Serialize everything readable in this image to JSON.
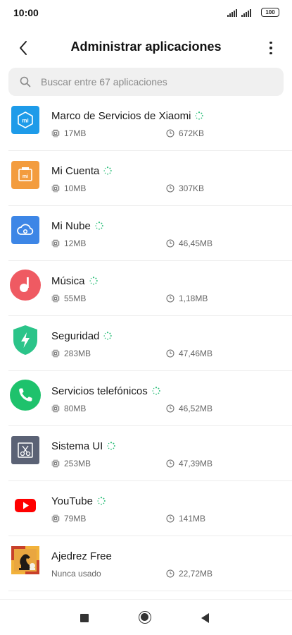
{
  "status_bar": {
    "time": "10:00",
    "battery": "100"
  },
  "header": {
    "title": "Administrar aplicaciones"
  },
  "search": {
    "placeholder": "Buscar entre 67 aplicaciones"
  },
  "apps": [
    {
      "name": "Marco de Servicios de Xiaomi",
      "size": "17MB",
      "cache": "672KB",
      "icon": "xiaomi-services-icon",
      "loading": true
    },
    {
      "name": "Mi Cuenta",
      "size": "10MB",
      "cache": "307KB",
      "icon": "mi-account-icon",
      "loading": true
    },
    {
      "name": "Mi Nube",
      "size": "12MB",
      "cache": "46,45MB",
      "icon": "mi-cloud-icon",
      "loading": true
    },
    {
      "name": "Música",
      "size": "55MB",
      "cache": "1,18MB",
      "icon": "music-icon",
      "loading": true
    },
    {
      "name": "Seguridad",
      "size": "283MB",
      "cache": "47,46MB",
      "icon": "security-icon",
      "loading": true
    },
    {
      "name": "Servicios telefónicos",
      "size": "80MB",
      "cache": "46,52MB",
      "icon": "phone-services-icon",
      "loading": true
    },
    {
      "name": "Sistema UI",
      "size": "253MB",
      "cache": "47,39MB",
      "icon": "system-ui-icon",
      "loading": true
    },
    {
      "name": "YouTube",
      "size": "79MB",
      "cache": "141MB",
      "icon": "youtube-icon",
      "loading": true
    },
    {
      "name": "Ajedrez Free",
      "size": "Nunca usado",
      "cache": "22,72MB",
      "icon": "chess-icon",
      "loading": false
    }
  ],
  "colors": {
    "accent_spinner": "#2ebf7a",
    "divider": "#ececec",
    "search_bg": "#f0f0f0"
  }
}
